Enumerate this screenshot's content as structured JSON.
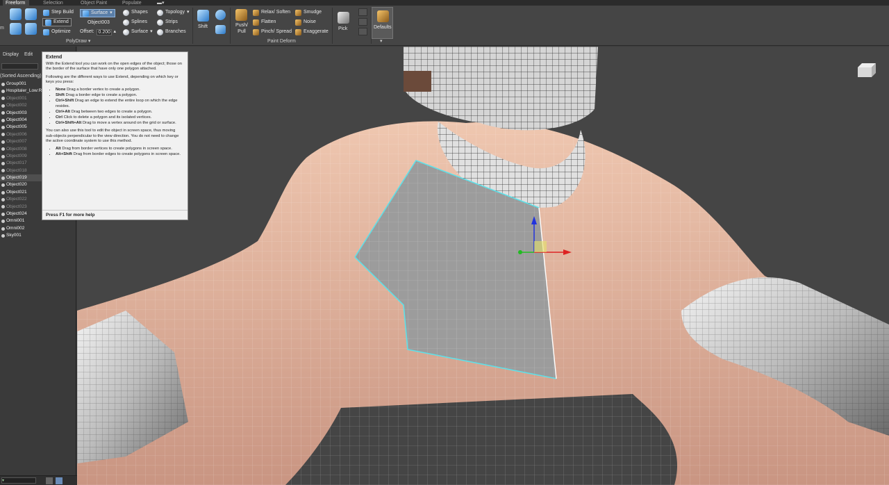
{
  "tabs": [
    "Freeform",
    "Selection",
    "Object Paint",
    "Populate"
  ],
  "ribbon": {
    "polydraw": {
      "step_build": "Step Build",
      "extend": "Extend",
      "optimize": "Optimize",
      "surface_mode": "Surface",
      "object_name": "Object003",
      "offset_label": "Offset:",
      "offset_value": "0.200",
      "shapes": "Shapes",
      "splines": "Splines",
      "surface": "Surface",
      "topology": "Topology",
      "strips": "Strips",
      "branches": "Branches",
      "group_label": "PolyDraw"
    },
    "shift": "Shift",
    "paint_deform": {
      "push_pull": "Push/ Pull",
      "relax_soften": "Relax/ Soften",
      "flatten": "Flatten",
      "pinch_spread": "Pinch/ Spread",
      "smudge": "Smudge",
      "noise": "Noise",
      "exaggerate": "Exaggerate",
      "group_label": "Paint Deform"
    },
    "pick": "Pick",
    "defaults": "Defaults"
  },
  "left_panel": {
    "menu": [
      "Display",
      "Edit"
    ],
    "sort_label": "(Sorted Ascending)",
    "objects": [
      {
        "name": "Group001",
        "state": "normal"
      },
      {
        "name": "Hospitaler_Low:R",
        "state": "normal"
      },
      {
        "name": "Object001",
        "state": "dim"
      },
      {
        "name": "Object002",
        "state": "dim"
      },
      {
        "name": "Object003",
        "state": "normal"
      },
      {
        "name": "Object004",
        "state": "normal"
      },
      {
        "name": "Object005",
        "state": "normal"
      },
      {
        "name": "Object006",
        "state": "dim"
      },
      {
        "name": "Object007",
        "state": "dim"
      },
      {
        "name": "Object008",
        "state": "dim"
      },
      {
        "name": "Object009",
        "state": "dim"
      },
      {
        "name": "Object017",
        "state": "dim"
      },
      {
        "name": "Object018",
        "state": "dim"
      },
      {
        "name": "Object019",
        "state": "selected"
      },
      {
        "name": "Object020",
        "state": "normal"
      },
      {
        "name": "Object021",
        "state": "normal"
      },
      {
        "name": "Object022",
        "state": "dim"
      },
      {
        "name": "Object023",
        "state": "dim"
      },
      {
        "name": "Object024",
        "state": "normal"
      },
      {
        "name": "Omni001",
        "state": "normal"
      },
      {
        "name": "Omni002",
        "state": "normal"
      },
      {
        "name": "Sky001",
        "state": "normal"
      }
    ]
  },
  "tooltip": {
    "title": "Extend",
    "intro": "With the Extend tool you can work on the open edges of the object; those on the border of the surface that have only one polygon attached.",
    "lead": "Following are the different ways to use Extend, depending on which key or keys you press:",
    "items": [
      {
        "key": "None",
        "text": "Drag a border vertex to create a polygon."
      },
      {
        "key": "Shift",
        "text": "Drag a border edge to create a polygon."
      },
      {
        "key": "Ctrl+Shift",
        "text": "Drag an edge to extend the entire loop on which the edge resides."
      },
      {
        "key": "Ctrl+Alt",
        "text": "Drag between two edges to create a polygon."
      },
      {
        "key": "Ctrl",
        "text": "Click to delete a polygon and its isolated vertices."
      },
      {
        "key": "Ctrl+Shift+Alt",
        "text": "Drag to move a vertex around on the grid or surface."
      }
    ],
    "screen_space": "You can also use this tool to edit the object in screen space, thus moving sub-objects perpendicular to the view direction. You do not need to change the active coordinate system to use this method.",
    "items2": [
      {
        "key": "Alt",
        "text": "Drag from border vertices to create polygons in screen space."
      },
      {
        "key": "Alt+Shift",
        "text": "Drag from border edges to create polygons in screen space."
      }
    ],
    "footer": "Press F1 for more help"
  },
  "colors": {
    "skin": "#e9b9a0",
    "patch": "#9e9e9e",
    "edge_highlight": "#5fe0e8",
    "armor": "#d8d8d8",
    "background": "#454545"
  }
}
